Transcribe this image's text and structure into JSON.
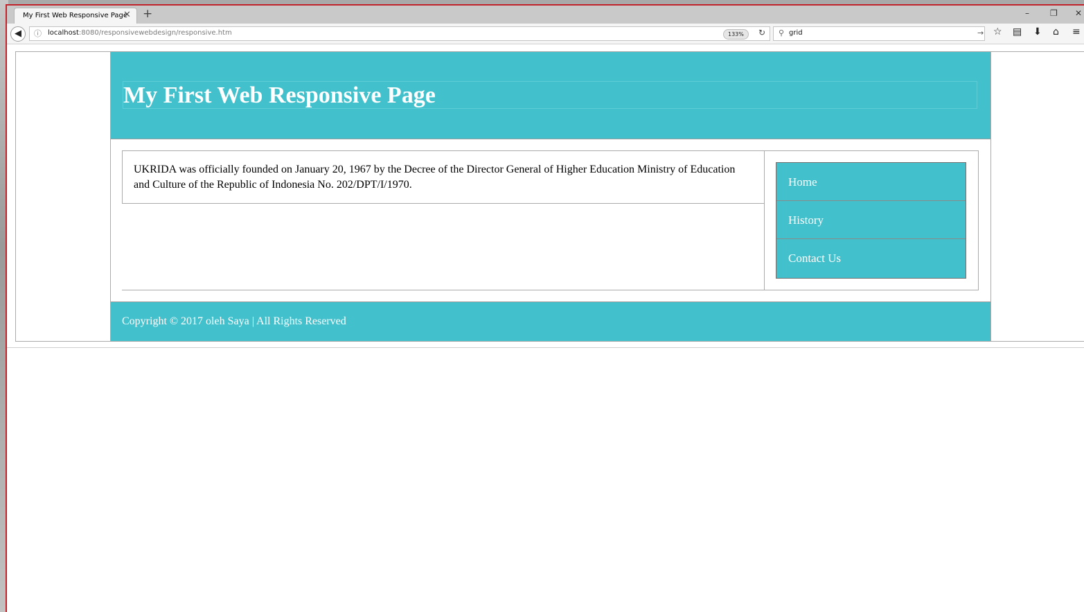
{
  "browser": {
    "tab_title": "My First Web Responsive Page",
    "tab_close": "✕",
    "new_tab": "+",
    "window_controls": {
      "minimize": "–",
      "restore": "❐",
      "close": "✕"
    },
    "back": "◀",
    "info": "ⓘ",
    "url_host": "localhost",
    "url_rest": ":8080/responsivewebdesign/responsive.htm",
    "zoom": "133%",
    "reload": "↻",
    "search_icon": "⚲",
    "search_value": "grid",
    "search_go": "→",
    "toolbar_icons": {
      "bookmark": "☆",
      "reading_list": "▤",
      "downloads": "⬇",
      "home": "⌂",
      "menu": "≡"
    }
  },
  "page": {
    "header": {
      "title": "My First Web Responsive Page"
    },
    "article": {
      "text": "UKRIDA was officially founded on January 20, 1967 by the Decree of the Director General of Higher Education Ministry of Education and Culture of the Republic of Indonesia No. 202/DPT/I/1970."
    },
    "menu": {
      "items": [
        {
          "label": "Home"
        },
        {
          "label": "History"
        },
        {
          "label": "Contact Us"
        }
      ]
    },
    "footer": {
      "text": "Copyright © 2017 oleh Saya | All Rights Reserved"
    }
  },
  "colors": {
    "accent": "#42c0cc",
    "window_border": "#c0242a"
  }
}
